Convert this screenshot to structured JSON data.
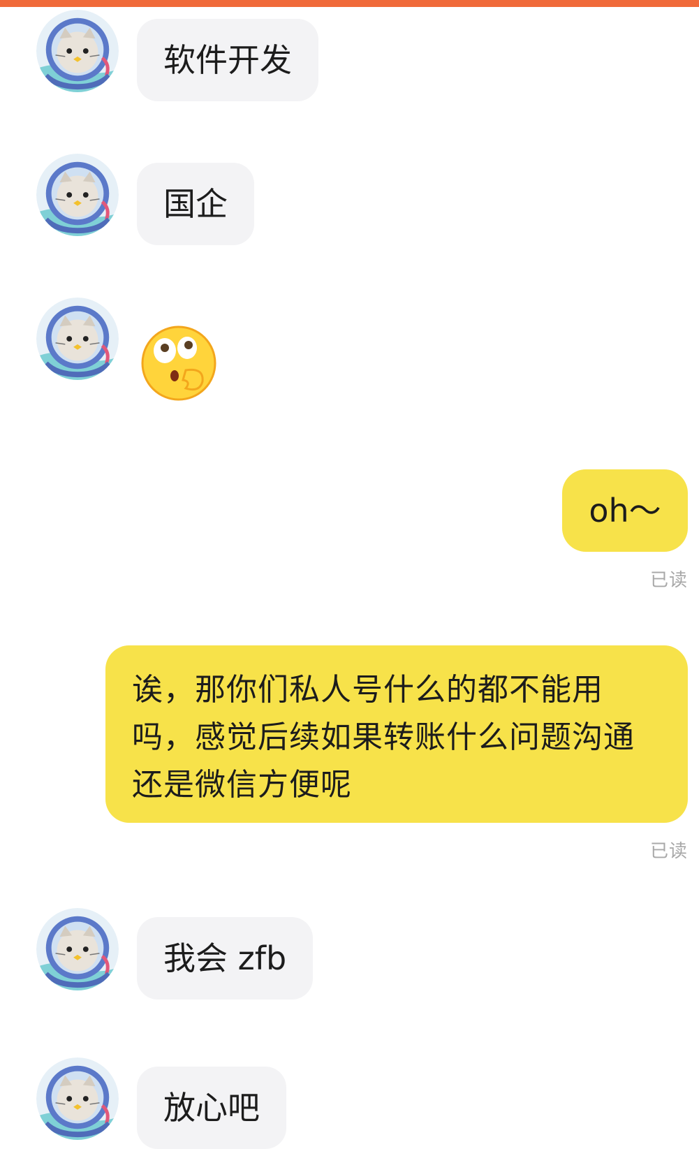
{
  "colors": {
    "top_bar": "#f06a3a",
    "incoming_bubble": "#f3f3f5",
    "outgoing_bubble": "#f7e24a",
    "read_text": "#a8a8a8"
  },
  "icons": {
    "avatar": "cat-astronaut-avatar-icon",
    "emoji": "surprised-thinking-emoji-icon"
  },
  "messages": [
    {
      "side": "incoming",
      "text": "软件开发"
    },
    {
      "side": "incoming",
      "text": "国企"
    },
    {
      "side": "incoming",
      "type": "emoji"
    },
    {
      "side": "outgoing",
      "text": "oh～",
      "status": "已读"
    },
    {
      "side": "outgoing",
      "text": "诶，那你们私人号什么的都不能用吗，感觉后续如果转账什么问题沟通还是微信方便呢",
      "status": "已读"
    },
    {
      "side": "incoming",
      "text": "我会 zfb"
    },
    {
      "side": "incoming",
      "text": "放心吧"
    }
  ]
}
